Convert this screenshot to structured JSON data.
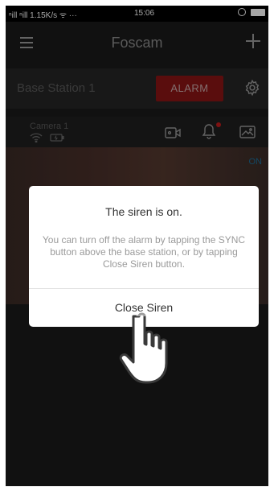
{
  "status_bar": {
    "signal_speed": "ⁿill ⁿill 1.15K/s ᯤ ···",
    "time": "15:06"
  },
  "header": {
    "title": "Foscam"
  },
  "base_station": {
    "name": "Base Station 1",
    "alarm_label": "ALARM"
  },
  "camera": {
    "name": "Camera 1",
    "status_on": "ON"
  },
  "dialog": {
    "title": "The siren is on.",
    "message": "You can turn off the alarm by tapping the SYNC button above the base station, or by tapping Close Siren button.",
    "button_label": "Close Siren"
  },
  "colors": {
    "alarm_red": "#8a1414",
    "notification_dot": "#c21d1d",
    "on_blue": "#1d6f9a",
    "background": "#1b1b1b"
  },
  "icons": [
    "menu-icon",
    "plus-icon",
    "gear-icon",
    "wifi-icon",
    "battery-icon",
    "video-icon",
    "bell-icon",
    "image-icon",
    "hand-pointer-icon"
  ]
}
